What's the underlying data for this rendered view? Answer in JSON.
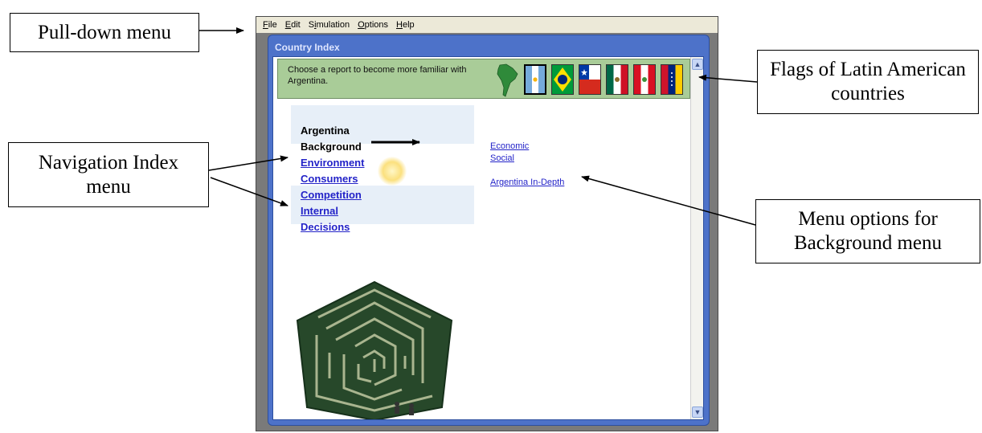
{
  "annotations": {
    "pulldown": "Pull-down menu",
    "flags": "Flags of Latin American countries",
    "navigation": "Navigation Index menu",
    "options": "Menu options for Background menu"
  },
  "menubar": {
    "items": [
      {
        "prefix": "",
        "hot": "F",
        "rest": "ile"
      },
      {
        "prefix": "",
        "hot": "E",
        "rest": "dit"
      },
      {
        "prefix": "S",
        "hot": "i",
        "rest": "mulation"
      },
      {
        "prefix": "",
        "hot": "O",
        "rest": "ptions"
      },
      {
        "prefix": "",
        "hot": "H",
        "rest": "elp"
      }
    ]
  },
  "panel": {
    "title": "Country Index"
  },
  "banner": {
    "text": "Choose a report to become more familiar with Argentina."
  },
  "flags": [
    {
      "country": "Argentina",
      "selected": true
    },
    {
      "country": "Brazil",
      "selected": false
    },
    {
      "country": "Chile",
      "selected": false
    },
    {
      "country": "Mexico",
      "selected": false
    },
    {
      "country": "Peru",
      "selected": false
    },
    {
      "country": "Venezuela",
      "selected": false
    }
  ],
  "nav": {
    "country": "Argentina",
    "current": "Background",
    "links": [
      "Environment",
      "Consumers",
      "Competition",
      "Internal",
      "Decisions"
    ]
  },
  "options": {
    "links": [
      "Economic",
      "Social",
      "Argentina In-Depth"
    ]
  },
  "colors": {
    "panel": "#4d72c9",
    "banner": "#a9cc98",
    "link": "#2323c8"
  }
}
